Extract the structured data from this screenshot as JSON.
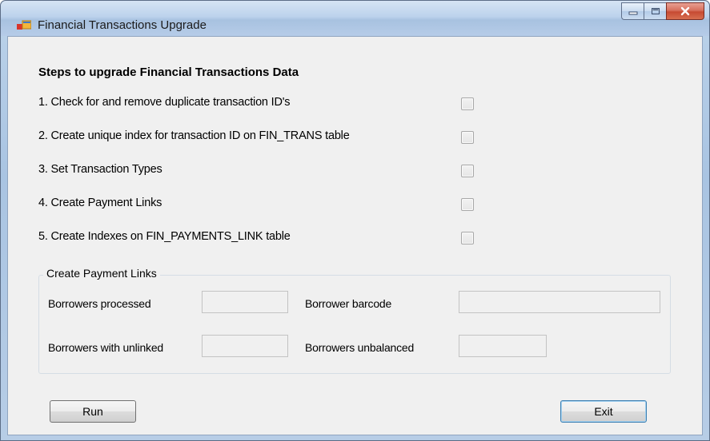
{
  "window": {
    "title": "Financial Transactions Upgrade",
    "controls": {
      "minimize_icon": "minimize-icon",
      "maximize_icon": "maximize-icon",
      "close_icon": "close-icon"
    }
  },
  "heading": "Steps to upgrade Financial Transactions Data",
  "steps": [
    {
      "label": "1. Check for and remove duplicate transaction ID's",
      "checked": false
    },
    {
      "label": "2. Create unique index for transaction ID on FIN_TRANS table",
      "checked": false
    },
    {
      "label": "3. Set Transaction Types",
      "checked": false
    },
    {
      "label": "4. Create Payment Links",
      "checked": false
    },
    {
      "label": "5. Create Indexes on FIN_PAYMENTS_LINK table",
      "checked": false
    }
  ],
  "payment_links": {
    "title": "Create Payment Links",
    "borrowers_processed": {
      "label": "Borrowers processed",
      "value": ""
    },
    "borrower_barcode": {
      "label": "Borrower barcode",
      "value": ""
    },
    "borrowers_with_unlinked": {
      "label": "Borrowers with unlinked",
      "value": ""
    },
    "borrowers_unbalanced": {
      "label": "Borrowers unbalanced",
      "value": ""
    }
  },
  "buttons": {
    "run": "Run",
    "exit": "Exit"
  },
  "colors": {
    "title_bar": "#bcd2ec",
    "client_bg": "#f0f0f0",
    "close_button": "#c64a33",
    "default_button_border": "#3c7fb1"
  }
}
